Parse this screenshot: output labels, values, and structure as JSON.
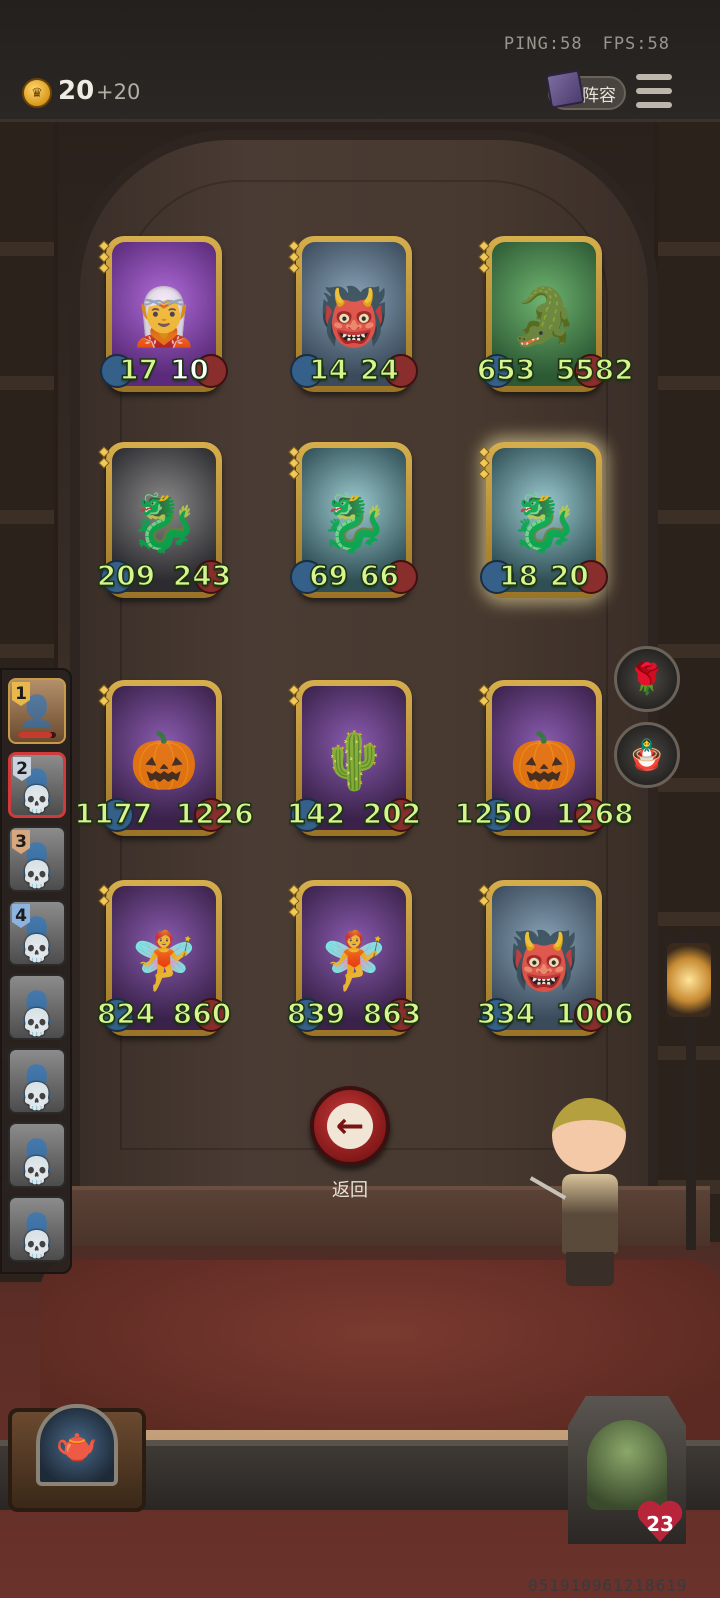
{
  "header": {
    "ping": "PING:58",
    "fps": "FPS:58",
    "gold": "20",
    "gold_income": "+20",
    "lineup_label": "阵容"
  },
  "board": {
    "rows": [
      [
        {
          "attack": "17",
          "health": "10",
          "creature": "horned elf girl",
          "tier": 3,
          "glow": false
        },
        {
          "attack": "14",
          "health": "24",
          "creature": "white-maned beast",
          "tier": 3,
          "glow": false
        },
        {
          "attack": "653",
          "health": "5582",
          "creature": "horned green dragon",
          "tier": 3,
          "glow": false
        }
      ],
      [
        {
          "attack": "209",
          "health": "243",
          "creature": "grey horned dragon",
          "tier": 2,
          "glow": false
        },
        {
          "attack": "69",
          "health": "66",
          "creature": "white serpent dragon",
          "tier": 3,
          "glow": false
        },
        {
          "attack": "18",
          "health": "20",
          "creature": "white serpent dragon",
          "tier": 3,
          "glow": true
        }
      ],
      [
        {
          "attack": "1177",
          "health": "1226",
          "creature": "pumpkin monster",
          "tier": 2,
          "glow": false
        },
        {
          "attack": "142",
          "health": "202",
          "creature": "cactus creature",
          "tier": 2,
          "glow": false
        },
        {
          "attack": "1250",
          "health": "1268",
          "creature": "pumpkin monster",
          "tier": 2,
          "glow": false
        }
      ],
      [
        {
          "attack": "824",
          "health": "860",
          "creature": "purple-haired dryad",
          "tier": 2,
          "glow": false
        },
        {
          "attack": "839",
          "health": "863",
          "creature": "purple-haired dryad",
          "tier": 3,
          "glow": false
        },
        {
          "attack": "334",
          "health": "1006",
          "creature": "white-maned beast",
          "tier": 2,
          "glow": false
        }
      ]
    ]
  },
  "team_rail": {
    "slots": [
      {
        "rank": "1",
        "state": "active",
        "health_fraction": 0.9
      },
      {
        "rank": "2",
        "state": "selected-dead"
      },
      {
        "rank": "3",
        "state": "dead"
      },
      {
        "rank": "4",
        "state": "dead"
      },
      {
        "rank": "",
        "state": "dead"
      },
      {
        "rank": "",
        "state": "dead"
      },
      {
        "rank": "",
        "state": "dead"
      },
      {
        "rank": "",
        "state": "dead"
      }
    ]
  },
  "side_items": [
    {
      "icon": "rose-icon"
    },
    {
      "icon": "voodoo-doll-icon"
    }
  ],
  "back_button": {
    "label": "返回"
  },
  "hero": {
    "health": "23"
  },
  "seed": "05191096121861​9"
}
